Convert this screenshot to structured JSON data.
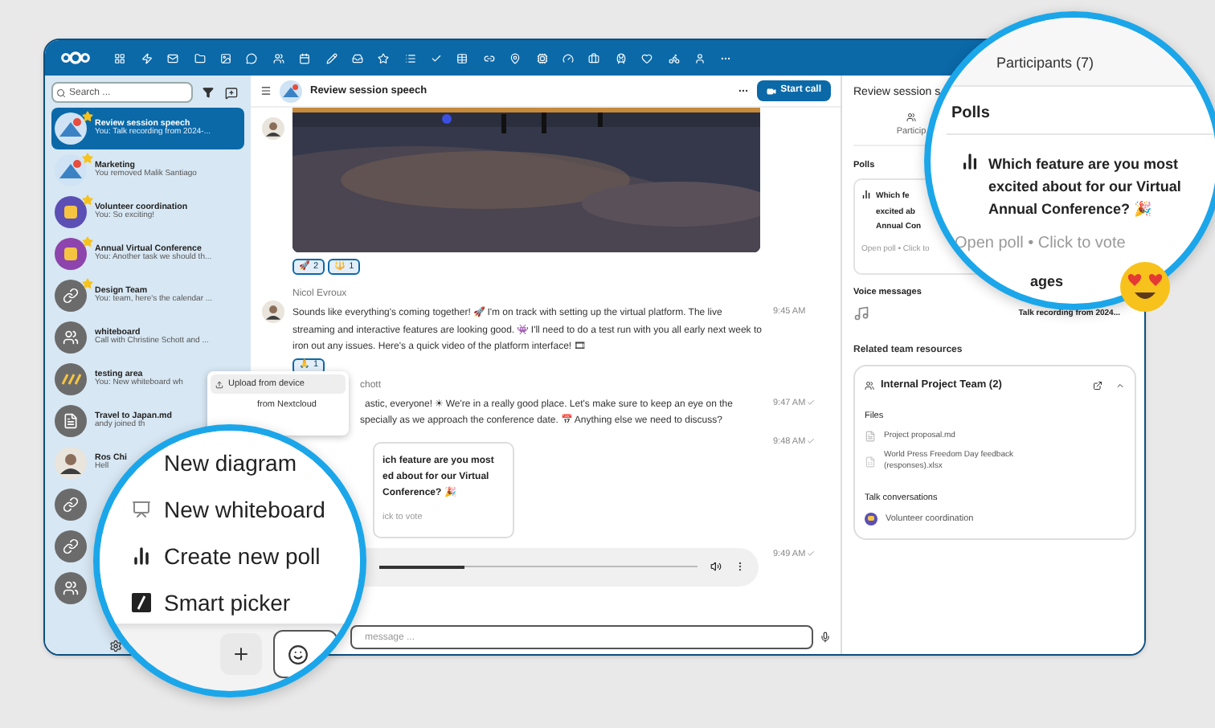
{
  "sidebar": {
    "search": {
      "placeholder": "Search ..."
    },
    "conversations": [
      {
        "name": "Review session speech",
        "preview": "You: Talk recording from 2024-...",
        "starred": true,
        "selected": true
      },
      {
        "name": "Marketing",
        "preview": "You removed Malik Santiago",
        "starred": true,
        "selected": false
      },
      {
        "name": "Volunteer coordination",
        "preview": "You: So exciting!",
        "kind": "emblem",
        "color": "#5b4fb6",
        "starred": true,
        "selected": false
      },
      {
        "name": "Annual Virtual Conference",
        "preview": "You: Another task we should th...",
        "kind": "emblem",
        "color": "#8e44ad",
        "starred": true,
        "selected": false
      },
      {
        "name": "Design Team",
        "preview": "You: team, here's the calendar ...",
        "kind": "link",
        "starred": true,
        "selected": false
      },
      {
        "name": "whiteboard",
        "preview": "Call with Christine Schott and ...",
        "kind": "group",
        "starred": false,
        "selected": false
      },
      {
        "name": "testing area",
        "preview": "You: New whiteboard wh",
        "kind": "pattern",
        "starred": false,
        "selected": false
      },
      {
        "name": "Travel to Japan.md",
        "preview": "andy joined th",
        "kind": "file",
        "starred": false,
        "selected": false
      },
      {
        "name": "Ros Chi",
        "preview": "Hell",
        "kind": "person",
        "starred": false,
        "selected": false
      },
      {
        "kind": "link",
        "starred": false,
        "selected": false
      },
      {
        "kind": "link",
        "starred": false,
        "selected": false
      },
      {
        "kind": "group",
        "starred": false,
        "selected": false
      }
    ]
  },
  "chat": {
    "title": "Review session speech",
    "start_call": "Start call",
    "messages": [
      {
        "reactions": [
          {
            "emoji": "🚀",
            "count": "2"
          },
          {
            "emoji": "🔱",
            "count": "1"
          }
        ]
      },
      {
        "kind": "text",
        "author": "Nicol Evroux",
        "text": "Sounds like everything's coming together! 🚀 I'm on track with setting up the virtual platform. The live streaming and interactive features are looking good. 👾 I'll need to do a test run with you all early next week to iron out any issues. Here's a quick video of the platform interface! 🎞",
        "time": "9:45 AM",
        "reactions": [
          {
            "emoji": "🙏",
            "count": "1"
          }
        ]
      },
      {
        "kind": "cut",
        "author": "chott",
        "lines": [
          "astic, everyone! ☀ We're in a really good place. Let's make sure to keep an eye on the",
          "specially as we approach the conference date. 📅 Anything else we need to discuss?"
        ],
        "time": "9:47 AM"
      },
      {
        "kind": "poll",
        "lines": [
          "ich feature are you most",
          "ed about for our Virtual",
          "Conference? 🎉"
        ],
        "footer": "ick to vote",
        "time": "9:48 AM"
      },
      {
        "kind": "audio",
        "level": 0.27,
        "time": "9:49 AM"
      }
    ],
    "composer": {
      "placeholder": "message ..."
    },
    "attach_menu": [
      {
        "label": "Upload from device",
        "selected": true
      },
      {
        "label": "from Nextcloud",
        "selected": false
      }
    ]
  },
  "right_panel": {
    "title": "Review session s",
    "participants_tab": "Particip",
    "polls_heading": "Polls",
    "poll": {
      "lines": [
        "Which fe",
        "excited ab",
        "Annual Con"
      ],
      "footer": "Open poll • Click to"
    },
    "voice_heading": "Voice messages",
    "voice_item": "Talk recording from 2024...",
    "resources_heading": "Related team resources",
    "team": {
      "name": "Internal Project Team (2)",
      "expanded": true,
      "files_heading": "Files",
      "files": [
        {
          "name": "Project proposal.md",
          "kind": "doc"
        },
        {
          "name": "World Press Freedom Day feedback (responses).xlsx",
          "kind": "sheet"
        }
      ],
      "talk_heading": "Talk conversations",
      "talks": [
        {
          "name": "Volunteer coordination",
          "color": "#5b4fb6"
        }
      ]
    }
  },
  "zoom_top": {
    "tab": "Participants (7)",
    "heading": "Polls",
    "question": "Which feature are you most excited about for our Virtual Annual Conference? 🎉",
    "footer": "Open poll • Click to vote",
    "cut_heading": "ages"
  },
  "zoom_bottom": {
    "items": [
      {
        "label": "New diagram",
        "kind": "none"
      },
      {
        "label": "New whiteboard",
        "kind": "whiteboard"
      },
      {
        "label": "Create new poll",
        "kind": "poll"
      },
      {
        "label": "Smart picker",
        "kind": "picker"
      }
    ]
  }
}
